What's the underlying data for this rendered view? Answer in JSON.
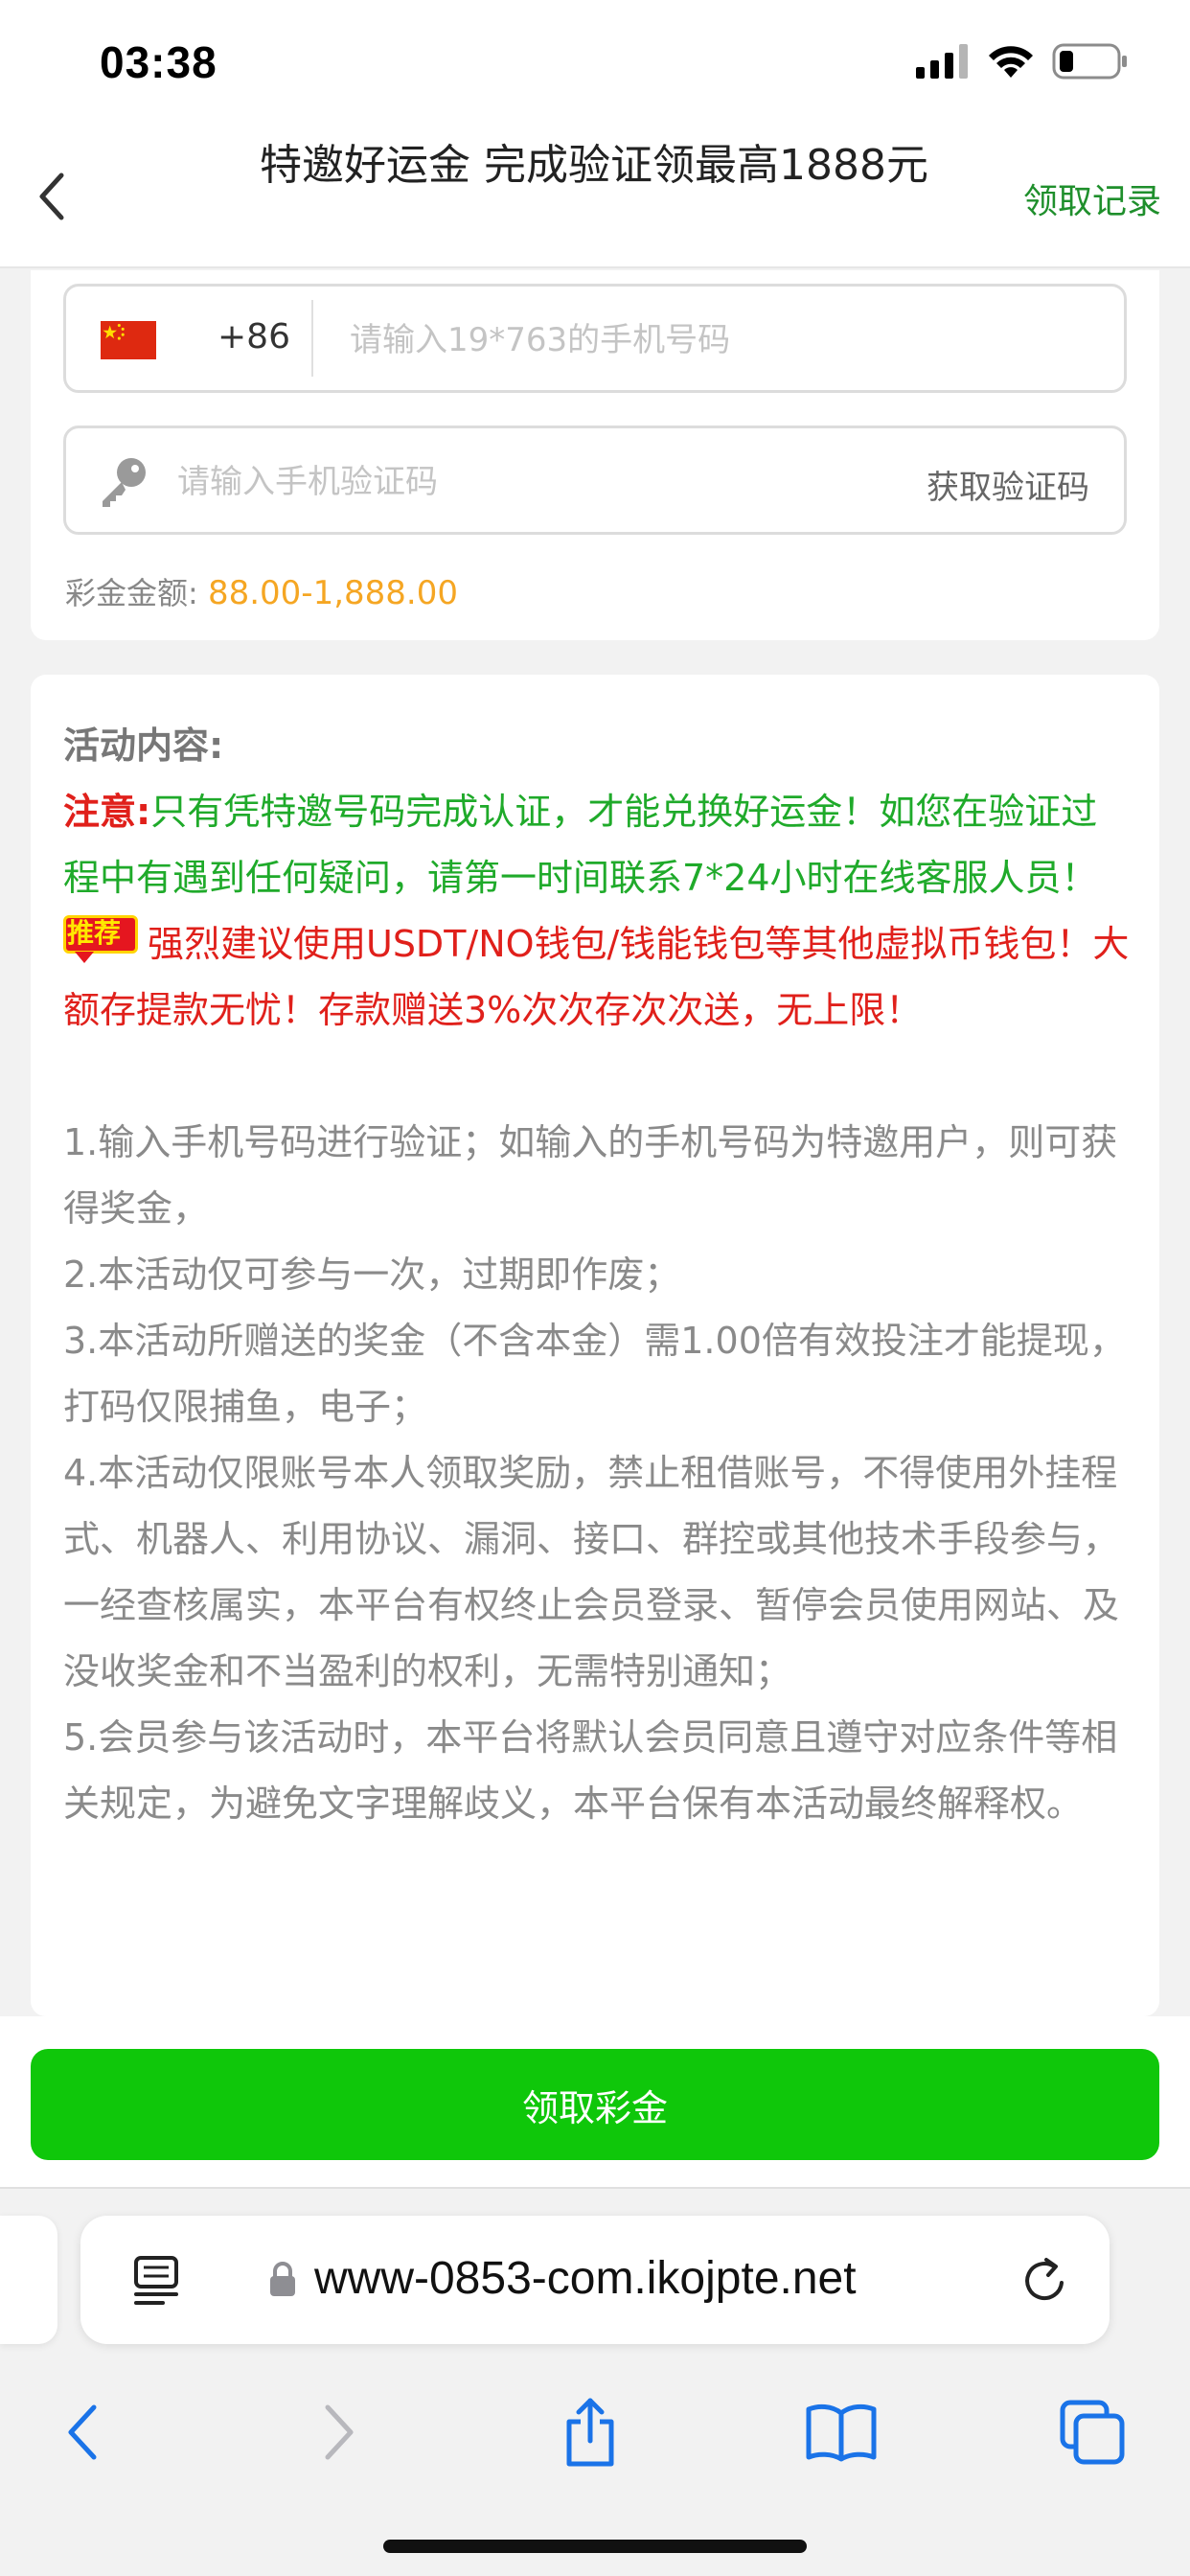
{
  "status_bar": {
    "time": "03:38"
  },
  "header": {
    "title": "特邀好运金 完成验证领最高1888元",
    "record_link": "领取记录"
  },
  "form": {
    "country_code": "+86",
    "phone_placeholder": "请输入19*763的手机号码",
    "code_placeholder": "请输入手机验证码",
    "get_code_label": "获取验证码",
    "amount_label": "彩金金额:",
    "amount_value": "88.00-1,888.00"
  },
  "activity": {
    "title": "活动内容:",
    "note_label": "注意:",
    "note_text": "只有凭特邀号码完成认证，才能兑换好运金！如您在验证过程中有遇到任何疑问，请第一时间联系7*24小时在线客服人员！",
    "recommend_tag": "推荐",
    "warning_text": "强烈建议使用USDT/NO钱包/钱能钱包等其他虚拟币钱包！大额存提款无忧！存款赠送3%次次存次次送，无上限！",
    "rules": [
      "1.输入手机号码进行验证；如输入的手机号码为特邀用户，则可获得奖金，",
      "2.本活动仅可参与一次，过期即作废；",
      "3.本活动所赠送的奖金（不含本金）需1.00倍有效投注才能提现，打码仅限捕鱼，电子；",
      "4.本活动仅限账号本人领取奖励，禁止租借账号，不得使用外挂程式、机器人、利用协议、漏洞、接口、群控或其他技术手段参与，一经查核属实，本平台有权终止会员登录、暂停会员使用网站、及没收奖金和不当盈利的权利，无需特别通知；",
      "5.会员参与该活动时，本平台将默认会员同意且遵守对应条件等相关规定，为避免文字理解歧义，本平台保有本活动最终解释权。"
    ]
  },
  "action": {
    "claim_button": "领取彩金"
  },
  "browser": {
    "url": "www-0853-com.ikojpte.net"
  },
  "colors": {
    "accent_green": "#0fc70a",
    "record_green": "#1f8f2c",
    "amount_orange": "#f5a623",
    "warning_red": "#e0201b",
    "note_green": "#1faa2a",
    "ios_blue": "#1a73e8"
  },
  "icons": [
    "cellular-signal-icon",
    "wifi-icon",
    "battery-icon",
    "back-chevron-icon",
    "china-flag-icon",
    "key-icon",
    "reader-mode-icon",
    "lock-icon",
    "reload-icon",
    "browser-back-icon",
    "browser-forward-icon",
    "share-icon",
    "bookmarks-icon",
    "tabs-icon"
  ]
}
